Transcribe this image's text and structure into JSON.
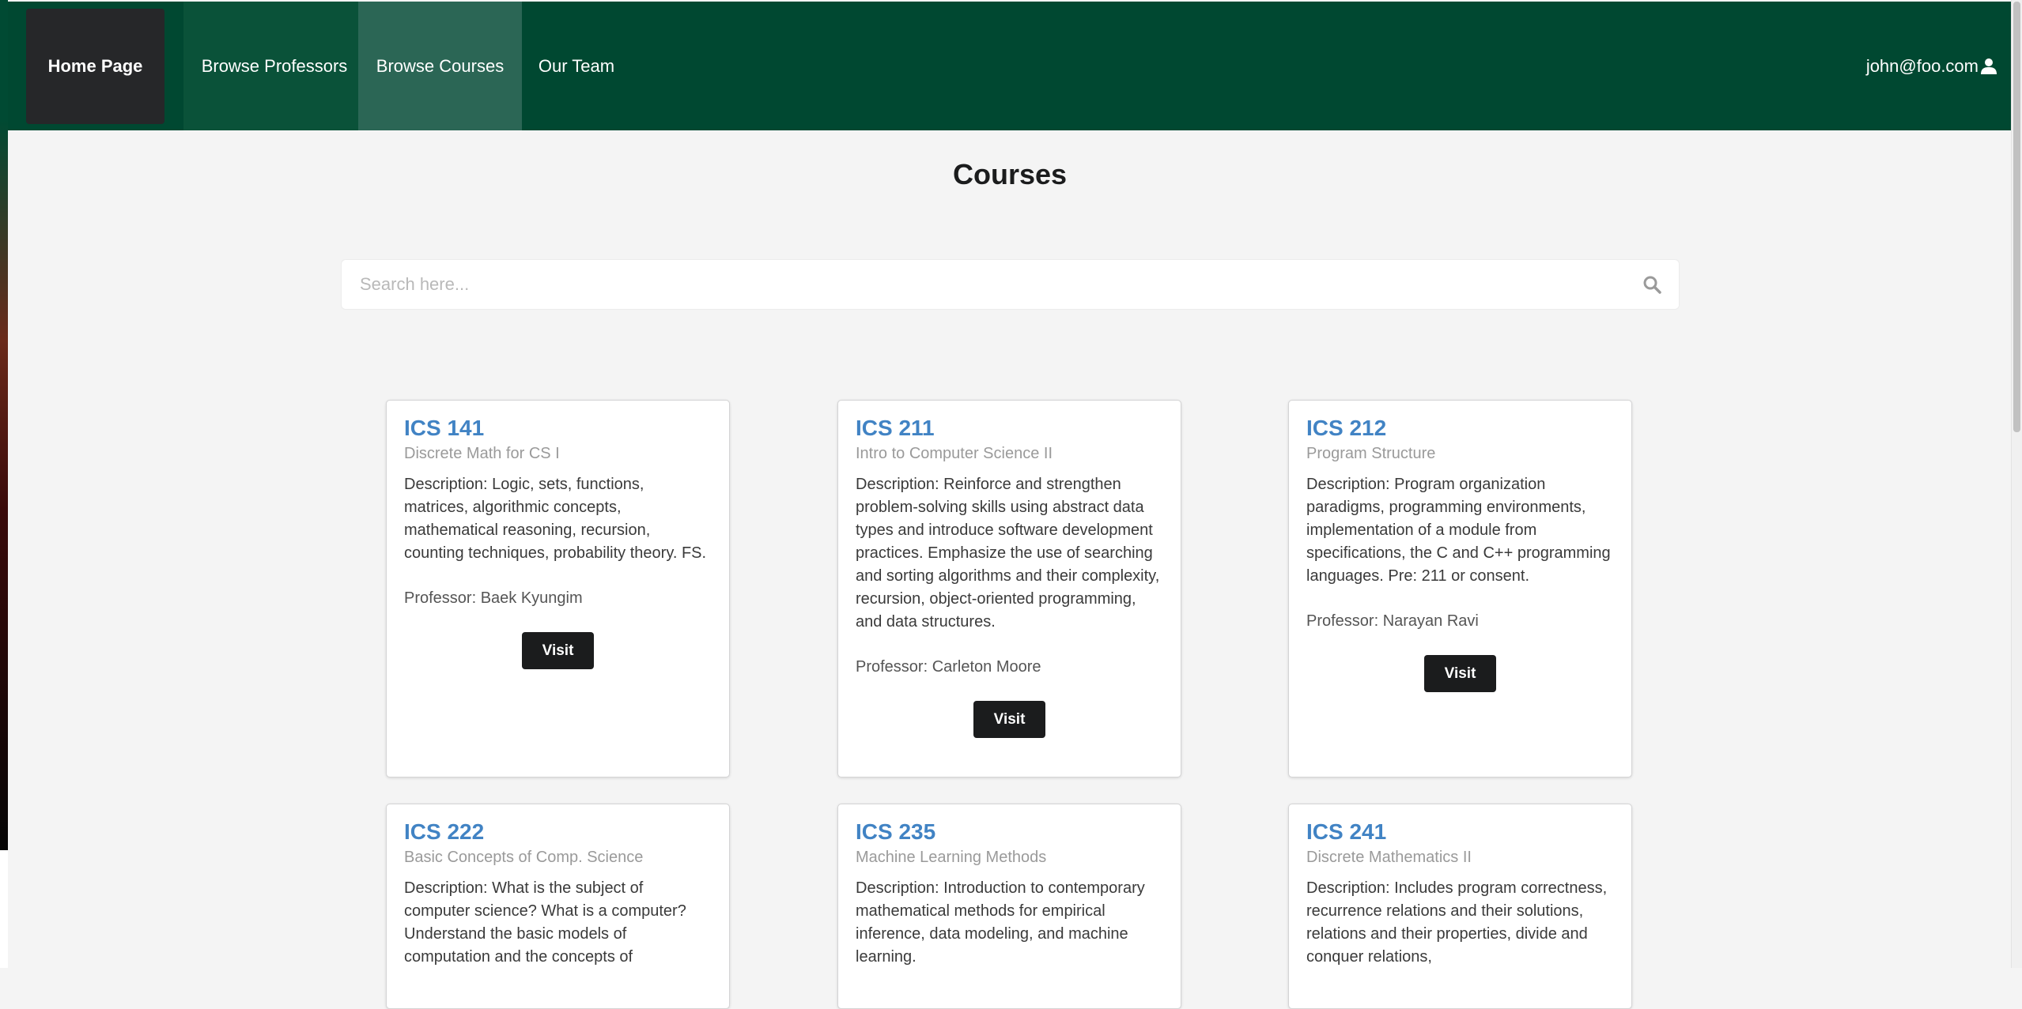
{
  "nav": {
    "home": "Home Page",
    "professors": "Browse Professors",
    "courses": "Browse Courses",
    "team": "Our Team",
    "user": "john@foo.com"
  },
  "page_title": "Courses",
  "search": {
    "placeholder": "Search here...",
    "value": ""
  },
  "courses": [
    {
      "code": "ICS 141",
      "title": "Discrete Math for CS I",
      "description": "Description: Logic, sets, functions, matrices, algorithmic concepts, mathematical reasoning, recursion, counting techniques, probability theory. FS.",
      "professor": "Professor: Baek Kyungim",
      "button": "Visit"
    },
    {
      "code": "ICS 211",
      "title": "Intro to Computer Science II",
      "description": "Description: Reinforce and strengthen problem-solving skills using abstract data types and introduce software development practices. Emphasize the use of searching and sorting algorithms and their complexity, recursion, object-oriented programming, and data structures.",
      "professor": "Professor: Carleton Moore",
      "button": "Visit"
    },
    {
      "code": "ICS 212",
      "title": "Program Structure",
      "description": "Description: Program organization paradigms, programming environments, implementation of a module from specifications, the C and C++ programming languages. Pre: 211 or consent.",
      "professor": "Professor: Narayan Ravi",
      "button": "Visit"
    },
    {
      "code": "ICS 222",
      "title": "Basic Concepts of Comp. Science",
      "description": "Description: What is the subject of computer science? What is a computer? Understand the basic models of computation and the concepts of",
      "professor": "",
      "button": ""
    },
    {
      "code": "ICS 235",
      "title": "Machine Learning Methods",
      "description": "Description: Introduction to contemporary mathematical methods for empirical inference, data modeling, and machine learning.",
      "professor": "",
      "button": ""
    },
    {
      "code": "ICS 241",
      "title": "Discrete Mathematics II",
      "description": "Description: Includes program correctness, recurrence relations and their solutions, relations and their properties, divide and conquer relations,",
      "professor": "",
      "button": ""
    }
  ]
}
